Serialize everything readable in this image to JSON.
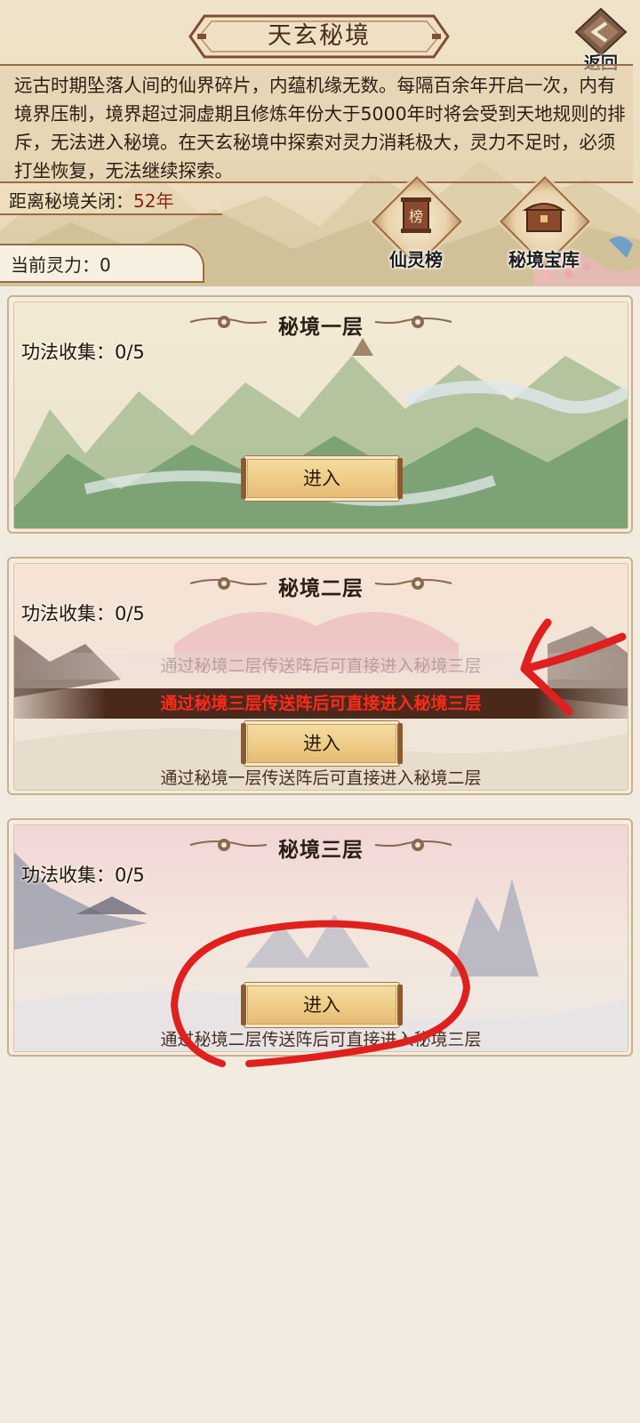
{
  "header": {
    "title": "天玄秘境",
    "back_label": "返回",
    "description": "远古时期坠落人间的仙界碎片，内蕴机缘无数。每隔百余年开启一次，内有境界压制，境界超过洞虚期且修炼年份大于5000年时将会受到天地规则的排斥，无法进入秘境。在天玄秘境中探索对灵力消耗极大，灵力不足时，必须打坐恢复，无法继续探索。",
    "countdown_label": "距离秘境关闭：",
    "countdown_value": "52年",
    "spirit_label": "当前灵力：",
    "spirit_value": "0",
    "shortcuts": [
      {
        "label": "仙灵榜",
        "icon": "ranking-scroll-icon",
        "glyph": "榜"
      },
      {
        "label": "秘境宝库",
        "icon": "treasure-chest-icon"
      }
    ]
  },
  "layers": [
    {
      "title": "秘境一层",
      "collect_label": "功法收集：",
      "collect_value": "0/5",
      "enter_label": "进入",
      "hint": ""
    },
    {
      "title": "秘境二层",
      "collect_label": "功法收集：",
      "collect_value": "0/5",
      "enter_label": "进入",
      "hint": "通过秘境一层传送阵后可直接进入秘境二层",
      "overlay_faded": "通过秘境二层传送阵后可直接进入秘境三层",
      "overlay_banner": "通过秘境三层传送阵后可直接进入秘境三层"
    },
    {
      "title": "秘境三层",
      "collect_label": "功法收集：",
      "collect_value": "0/5",
      "enter_label": "进入",
      "hint": "通过秘境二层传送阵后可直接进入秘境三层"
    }
  ],
  "colors": {
    "annotation_red": "#e0201e",
    "countdown_value": "#8b1f12",
    "banner_text": "#ff2a1a",
    "button_gold": "#edc983"
  }
}
